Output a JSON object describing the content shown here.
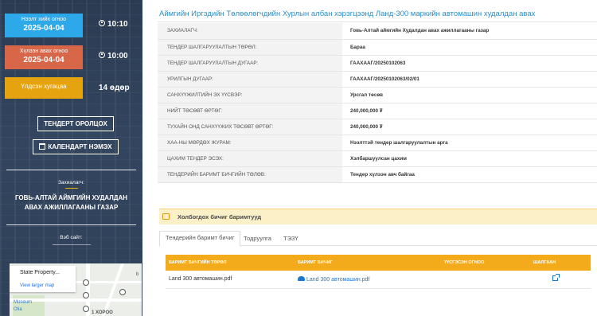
{
  "sidebar": {
    "dates": [
      {
        "label": "Нээлт хийх огноо",
        "date": "2025-04-04",
        "time": "10:10",
        "color": "#2da9ea"
      },
      {
        "label": "Хүлээн авах огноо",
        "date": "2025-04-04",
        "time": "10:00",
        "color": "#d8674a"
      }
    ],
    "duration": {
      "label": "Үлдсэн хугацаа",
      "value": "14 өдөр",
      "color": "#e5a30f"
    },
    "join_button": "ТЕНДЕРТ ОРОЛЦОХ",
    "calendar_button": "КАЛЕНДАРТ НЭМЭХ",
    "owner_label": "Захиалагч:",
    "owner_name": "ГОВЬ-АЛТАЙ АЙМГИЙН ХУДАЛДАН АВАХ АЖИЛЛАГААНЫ ГАЗАР",
    "website_label": "Вэб сайт:",
    "map": {
      "place": "State Property...",
      "link": "View larger map",
      "label_museum": "Museum",
      "label_olia": "Olia",
      "label_khoroo": "1 ХОРОО",
      "label_b": "b"
    }
  },
  "main": {
    "title": "Аймгийн Иргэдийн Төлөөлөгчдийн Хурлын албан хэрэгцээнд Ланд-300 маркийн автомашин худалдан авах",
    "info": [
      {
        "key": "ЗАХИАЛАГЧ:",
        "value": "Говь-Алтай аймгийн Худалдан авах ажиллагааны газар"
      },
      {
        "key": "ТЕНДЕР ШАЛГАРУУЛАЛТЫН ТӨРӨЛ:",
        "value": "Бараа"
      },
      {
        "key": "ТЕНДЕР ШАЛГАРУУЛАЛТЫН ДУГААР:",
        "value": "ГААХААГ/20250102063"
      },
      {
        "key": "УРИЛГЫН ДУГААР:",
        "value": "ГААХААГ/20250102063/02/01"
      },
      {
        "key": "САНХҮҮЖИЛТИЙН ЭХ ҮҮСВЭР:",
        "value": "Урсгал төсөв"
      },
      {
        "key": "НИЙТ ТӨСӨВТ ӨРТӨГ:",
        "value": "240,000,000 ₮"
      },
      {
        "key": "ТУХАЙН ОНД САНХҮҮЖИХ ТӨСӨВТ ӨРТӨГ:",
        "value": "240,000,000 ₮"
      },
      {
        "key": "ХАА-НЫ МӨРДӨХ ЖУРАМ:",
        "value": "Нээлттэй тендер шалгаруулалтын арга"
      },
      {
        "key": "ЦАХИМ ТЕНДЕР ЭСЭХ:",
        "value": "Хэлбаршуулсан цахим"
      },
      {
        "key": "ТЕНДЕРИЙН БАРИМТ БИЧГИЙН ТӨЛӨВ:",
        "value": "Тендер хүлээн авч байгаа"
      }
    ],
    "docs_title": "Холбогдох бичиг баримтууд",
    "tabs": [
      "Тендерийн баримт бичиг",
      "Тодруулга",
      "ТЭЗҮ"
    ],
    "docs_columns": [
      "БАРИМТ БИЧГИЙН ТӨРӨЛ",
      "БАРИМТ БИЧИГ",
      "ҮҮСГЭСЭН ОГНОО",
      "ШАЛГААН"
    ],
    "docs_rows": [
      {
        "type": "Land 300 автомашин.pdf",
        "file": "Land 300 автомашин.pdf",
        "created": ""
      }
    ]
  }
}
